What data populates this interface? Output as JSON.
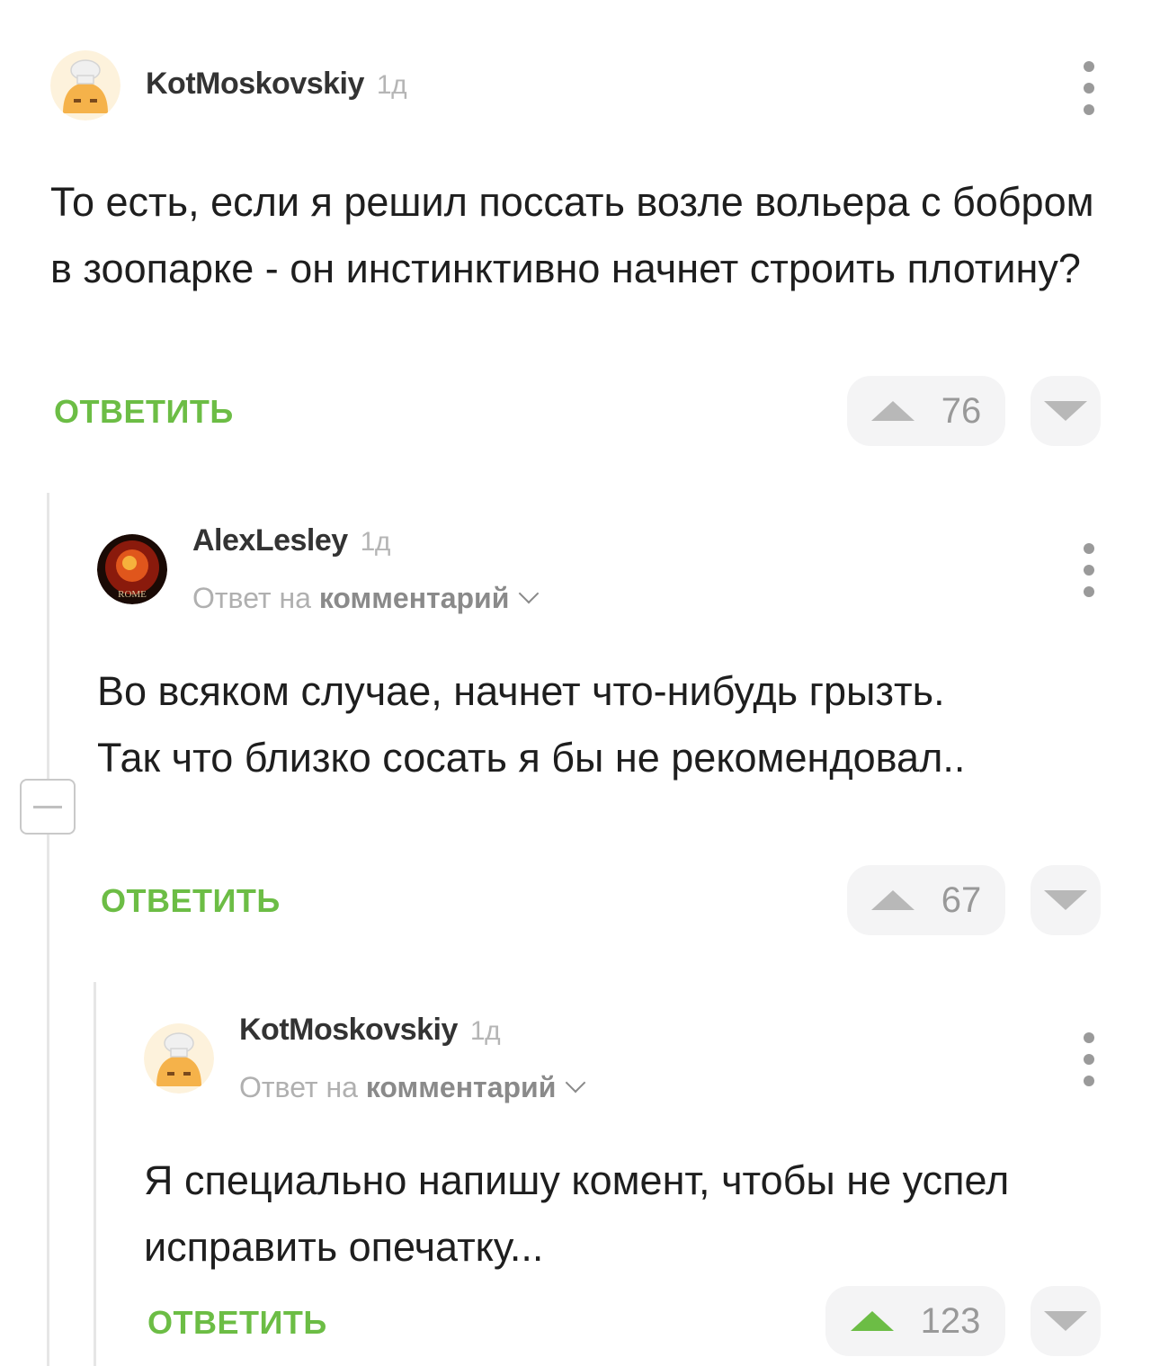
{
  "comments": [
    {
      "author": "KotMoskovskiy",
      "time": "1д",
      "text": "То есть, если я решил поссать возле вольера с бобром в зоопарке - он инстинктивно начнет строить плотину?",
      "reply_label": "ОТВЕТИТЬ",
      "votes": "76",
      "upvoted": false
    },
    {
      "author": "AlexLesley",
      "time": "1д",
      "reply_to_prefix": "Ответ на",
      "reply_to_link": "комментарий",
      "avatar_text": "ROME",
      "text": "Во всяком случае, начнет что-нибудь грызть. Так что близко сосать я бы не рекомендовал..",
      "reply_label": "ОТВЕТИТЬ",
      "votes": "67",
      "upvoted": false
    },
    {
      "author": "KotMoskovskiy",
      "time": "1д",
      "reply_to_prefix": "Ответ на",
      "reply_to_link": "комментарий",
      "text": "Я специально напишу комент, чтобы не успел исправить опечатку...",
      "reply_label": "ОТВЕТИТЬ",
      "votes": "123",
      "upvoted": true
    }
  ],
  "icons": {
    "menu": "vertical-dots-icon",
    "upvote": "triangle-up-icon",
    "downvote": "triangle-down-icon",
    "collapse": "minus-icon",
    "chevron": "chevron-down-icon"
  },
  "colors": {
    "accent_green": "#6cbd45",
    "vote_bg": "#f4f4f5",
    "muted": "#b0b0b0"
  }
}
